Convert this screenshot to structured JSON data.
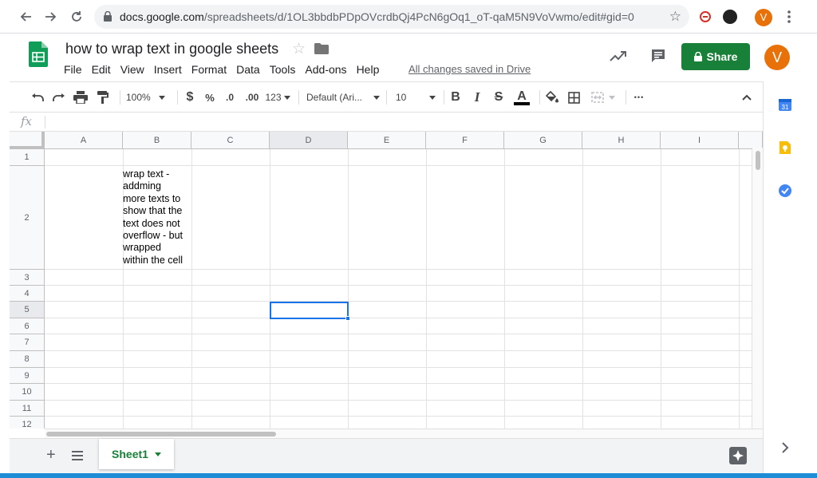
{
  "browser": {
    "url_host": "docs.google.com",
    "url_path": "/spreadsheets/d/1OL3bbdbPDpOVcrdbQj4PcN6gOq1_oT-qaM5N9VoVwmo/edit#gid=0",
    "avatar_letter": "V"
  },
  "doc": {
    "title": "how to wrap text in google sheets",
    "saved_status": "All changes saved in Drive",
    "share_label": "Share",
    "avatar_letter": "V"
  },
  "menu": [
    "File",
    "Edit",
    "View",
    "Insert",
    "Format",
    "Data",
    "Tools",
    "Add-ons",
    "Help"
  ],
  "toolbar": {
    "zoom": "100%",
    "currency": "$",
    "percent": "%",
    "dec_decrease": ".0",
    "dec_increase": ".00",
    "more_formats": "123",
    "font": "Default (Ari...",
    "font_size": "10",
    "bold": "B",
    "italic": "I",
    "strike": "S",
    "text_color": "A",
    "more": "•••"
  },
  "formula_bar": {
    "fx": "fx"
  },
  "grid": {
    "columns": [
      "A",
      "B",
      "C",
      "D",
      "E",
      "F",
      "G",
      "H",
      "I"
    ],
    "rows": [
      "1",
      "2",
      "3",
      "4",
      "5",
      "6",
      "7",
      "8",
      "9",
      "10",
      "11",
      "12"
    ],
    "active_column": "D",
    "active_row": "5",
    "cell_B2": "wrap text -\naddming\nmore texts to\nshow that the\ntext does not\noverflow - but\nwrapped\nwithin the cell"
  },
  "sheets": {
    "active": "Sheet1"
  },
  "colors": {
    "accent_green": "#188038",
    "selection_blue": "#1a73e8",
    "avatar_orange": "#e8710a"
  }
}
